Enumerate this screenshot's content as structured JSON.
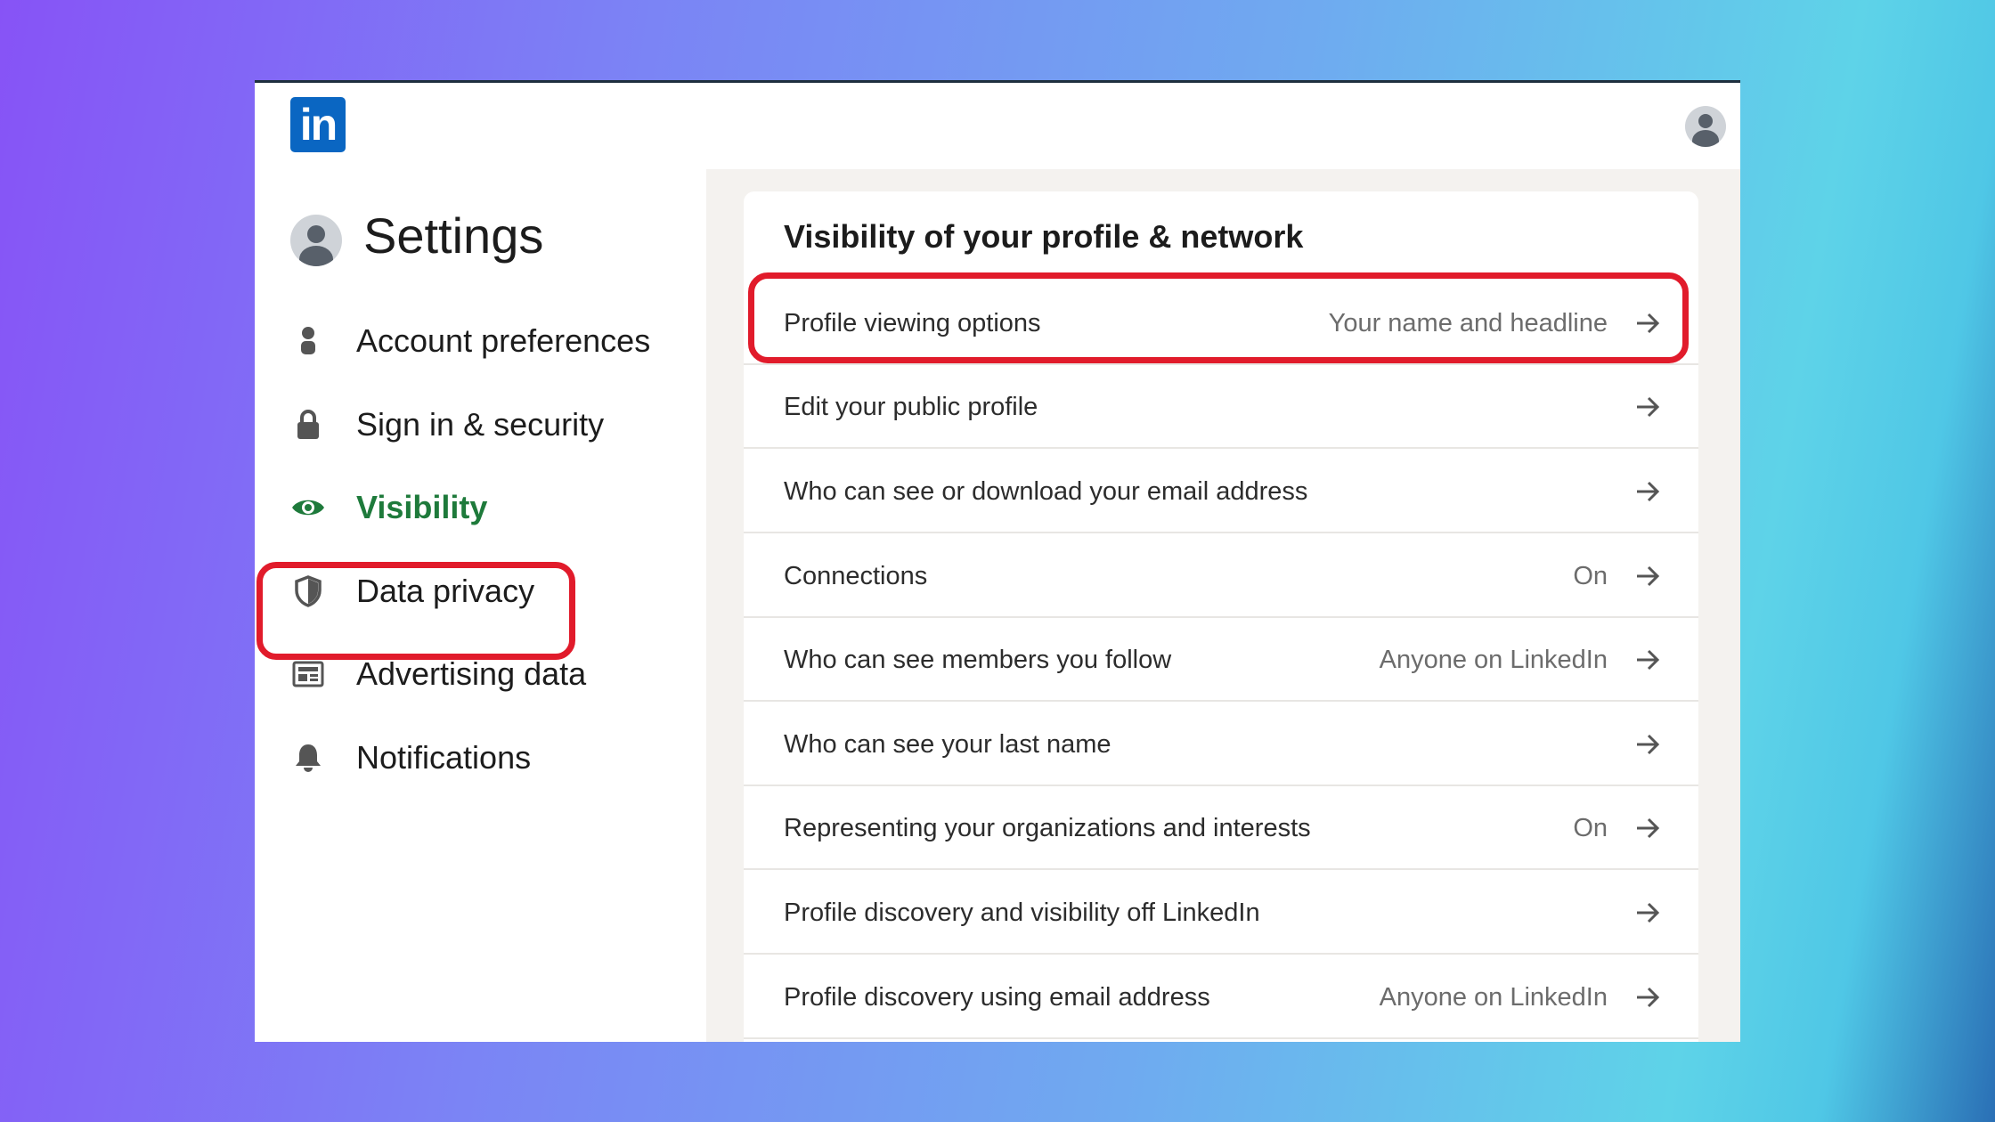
{
  "logo_text": "in",
  "sidebar": {
    "title": "Settings",
    "items": [
      {
        "label": "Account preferences",
        "icon": "person-icon"
      },
      {
        "label": "Sign in & security",
        "icon": "lock-icon"
      },
      {
        "label": "Visibility",
        "icon": "eye-icon",
        "active": true
      },
      {
        "label": "Data privacy",
        "icon": "shield-icon"
      },
      {
        "label": "Advertising data",
        "icon": "ad-card-icon"
      },
      {
        "label": "Notifications",
        "icon": "bell-icon"
      }
    ]
  },
  "main": {
    "section_title": "Visibility of your profile & network",
    "rows": [
      {
        "label": "Profile viewing options",
        "value": "Your name and headline"
      },
      {
        "label": "Edit your public profile",
        "value": ""
      },
      {
        "label": "Who can see or download your email address",
        "value": ""
      },
      {
        "label": "Connections",
        "value": "On"
      },
      {
        "label": "Who can see members you follow",
        "value": "Anyone on LinkedIn"
      },
      {
        "label": "Who can see your last name",
        "value": ""
      },
      {
        "label": "Representing your organizations and interests",
        "value": "On"
      },
      {
        "label": "Profile discovery and visibility off LinkedIn",
        "value": ""
      },
      {
        "label": "Profile discovery using email address",
        "value": "Anyone on LinkedIn"
      }
    ]
  },
  "colors": {
    "brand": "#0a66c2",
    "active_green": "#1e7a3b",
    "highlight_red": "#e11b2b"
  }
}
